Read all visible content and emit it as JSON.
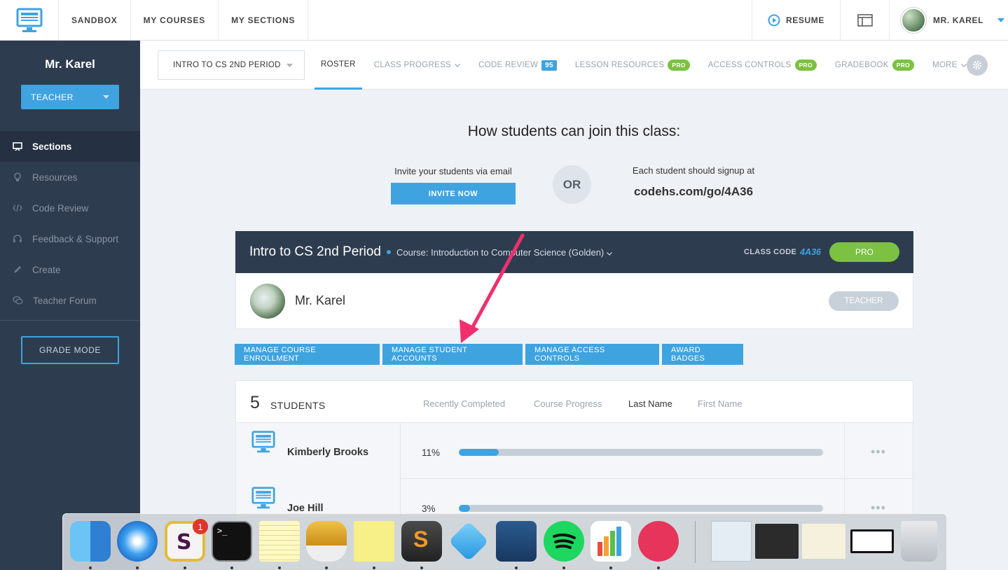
{
  "topbar": {
    "nav": [
      "SANDBOX",
      "MY COURSES",
      "MY SECTIONS"
    ],
    "resume": "RESUME",
    "user": "MR. KAREL"
  },
  "sidebar": {
    "name": "Mr. Karel",
    "role": "TEACHER",
    "items": [
      {
        "label": "Sections",
        "icon": "presentation-icon"
      },
      {
        "label": "Resources",
        "icon": "lightbulb-icon"
      },
      {
        "label": "Code Review",
        "icon": "code-icon"
      },
      {
        "label": "Feedback & Support",
        "icon": "headset-icon"
      },
      {
        "label": "Create",
        "icon": "pencil-icon"
      },
      {
        "label": "Teacher Forum",
        "icon": "chat-icon"
      }
    ],
    "grade_mode": "GRADE MODE"
  },
  "subnav": {
    "section": "INTRO TO CS 2ND PERIOD",
    "tabs": {
      "roster": "ROSTER",
      "class_progress": "CLASS PROGRESS",
      "code_review": "CODE REVIEW",
      "code_review_count": "95",
      "lesson_resources": "LESSON RESOURCES",
      "access_controls": "ACCESS CONTROLS",
      "gradebook": "GRADEBOOK",
      "more": "MORE",
      "pro": "PRO"
    }
  },
  "join": {
    "title": "How students can join this class:",
    "invite_text": "Invite your students via email",
    "invite_button": "INVITE NOW",
    "or": "OR",
    "signup_text": "Each student should signup at",
    "signup_url": "codehs.com/go/4A36"
  },
  "class_card": {
    "name": "Intro to CS 2nd Period",
    "course": "Course: Introduction to Computer Science (Golden)",
    "code_label": "CLASS CODE",
    "code": "4A36",
    "pro": "PRO",
    "teacher_name": "Mr. Karel",
    "teacher_badge": "TEACHER"
  },
  "actions": [
    "MANAGE COURSE ENROLLMENT",
    "MANAGE STUDENT ACCOUNTS",
    "MANAGE ACCESS CONTROLS",
    "AWARD BADGES"
  ],
  "students": {
    "count": "5",
    "label": "STUDENTS",
    "sort_options": [
      "Recently Completed",
      "Course Progress",
      "Last Name",
      "First Name"
    ],
    "active_sort": "Last Name",
    "rows": [
      {
        "name": "Kimberly Brooks",
        "progress_label": "11%",
        "progress": 0.11
      },
      {
        "name": "Joe Hill",
        "progress_label": "3%",
        "progress": 0.03
      }
    ]
  },
  "dock": {
    "apps": [
      "finder-icon",
      "safari-icon",
      "slack-icon",
      "terminal-icon",
      "notes-icon",
      "sequel-pro-icon",
      "stickies-icon",
      "sublime-text-icon",
      "dropbox-icon",
      "virtualbox-icon",
      "spotify-icon",
      "numbers-icon",
      "skitch-icon",
      "xlsx-document-icon",
      "code-window-icon",
      "spreadsheet-window-icon",
      "blank-window-icon",
      "trash-icon"
    ],
    "slack_badge": "1"
  },
  "colors": {
    "accent": "#3fa3e0",
    "sidebar": "#2e3c4f",
    "pro": "#7cc142",
    "arrow": "#f0306e"
  }
}
